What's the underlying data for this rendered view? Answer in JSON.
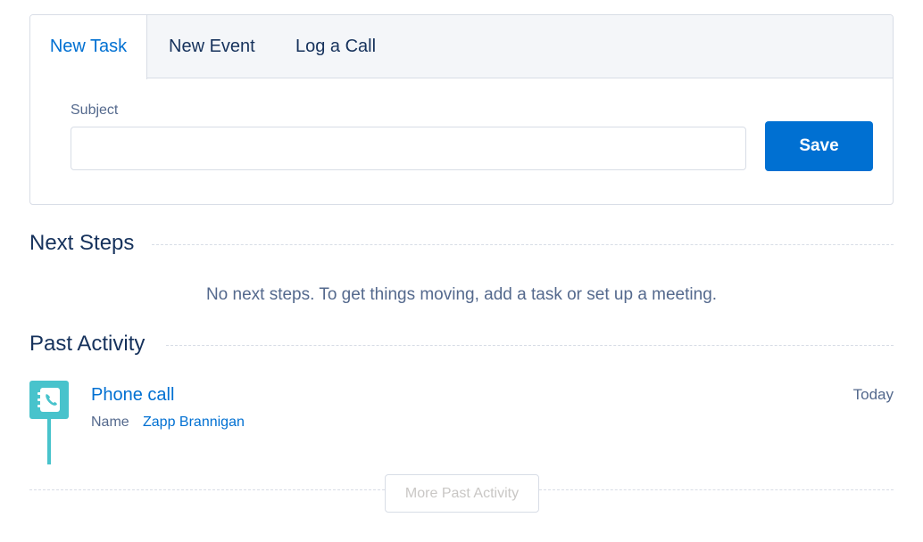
{
  "tabs": [
    {
      "label": "New Task",
      "active": true
    },
    {
      "label": "New Event",
      "active": false
    },
    {
      "label": "Log a Call",
      "active": false
    }
  ],
  "form": {
    "subject_label": "Subject",
    "subject_value": "",
    "subject_placeholder": "",
    "save_label": "Save"
  },
  "next_steps": {
    "title": "Next Steps",
    "empty_message": "No next steps. To get things moving, add a task or set up a meeting."
  },
  "past_activity": {
    "title": "Past Activity",
    "items": [
      {
        "title": "Phone call",
        "date": "Today",
        "field_label": "Name",
        "field_value": "Zapp Brannigan",
        "icon": "phone-call-icon"
      }
    ],
    "more_label": "More Past Activity"
  },
  "colors": {
    "brand": "#0070d2",
    "call_icon": "#48c3cc",
    "text": "#16325c",
    "muted": "#54698d",
    "border": "#d8dde6"
  }
}
